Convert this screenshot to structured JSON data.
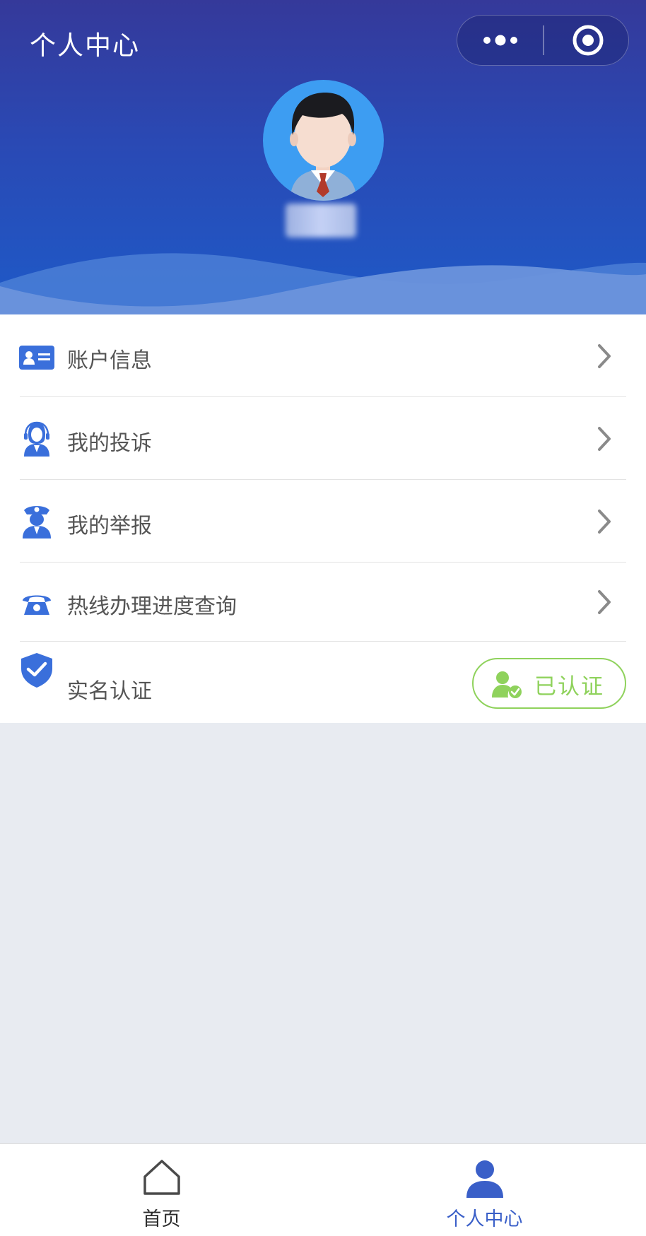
{
  "header": {
    "title": "个人中心",
    "more_icon": "more-dots-icon",
    "close_icon": "target-circle-icon"
  },
  "profile": {
    "avatar_icon": "male-user-avatar-icon"
  },
  "menu": {
    "items": [
      {
        "label": "账户信息",
        "icon": "id-card-icon"
      },
      {
        "label": "我的投诉",
        "icon": "customer-service-icon"
      },
      {
        "label": "我的举报",
        "icon": "police-officer-icon"
      },
      {
        "label": "热线办理进度查询",
        "icon": "telephone-icon"
      },
      {
        "label": "实名认证",
        "icon": "shield-check-icon"
      }
    ],
    "verification_status": "已认证",
    "verification_icon": "user-verified-icon"
  },
  "tabbar": {
    "tabs": [
      {
        "label": "首页",
        "icon": "home-icon",
        "active": false
      },
      {
        "label": "个人中心",
        "icon": "user-icon",
        "active": true
      }
    ]
  },
  "colors": {
    "header_top": "#35399a",
    "header_bottom": "#1e5ac8",
    "accent_blue": "#3a6fdb",
    "verified_green": "#8fd25c",
    "tab_active": "#3a5fc8",
    "background": "#e8ebf1"
  }
}
